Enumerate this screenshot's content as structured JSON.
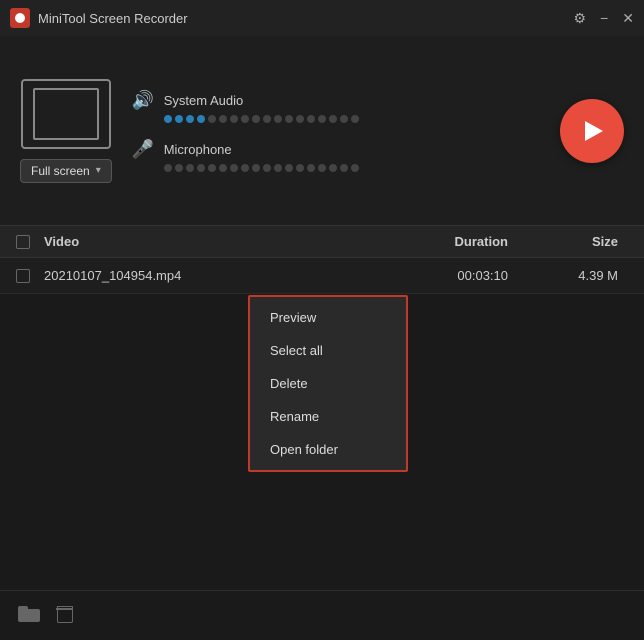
{
  "titleBar": {
    "logo": "minitool-logo",
    "title": "MiniTool Screen Recorder",
    "settingsIcon": "⚙",
    "minimizeIcon": "−",
    "closeIcon": "✕"
  },
  "captureArea": {
    "mode": "Full screen",
    "chevron": "▾"
  },
  "audio": {
    "systemAudio": {
      "label": "System Audio",
      "icon": "🔊",
      "activeDots": 4,
      "totalDots": 18
    },
    "microphone": {
      "label": "Microphone",
      "icon": "🎤",
      "activeDots": 0,
      "totalDots": 18
    }
  },
  "recordButton": {
    "label": "Record"
  },
  "table": {
    "headers": {
      "video": "Video",
      "duration": "Duration",
      "size": "Size"
    },
    "rows": [
      {
        "filename": "20210107_104954.mp4",
        "duration": "00:03:10",
        "size": "4.39 M"
      }
    ]
  },
  "contextMenu": {
    "items": [
      "Preview",
      "Select all",
      "Delete",
      "Rename",
      "Open folder"
    ]
  },
  "toolbar": {
    "folderLabel": "Open folder",
    "deleteLabel": "Delete"
  }
}
